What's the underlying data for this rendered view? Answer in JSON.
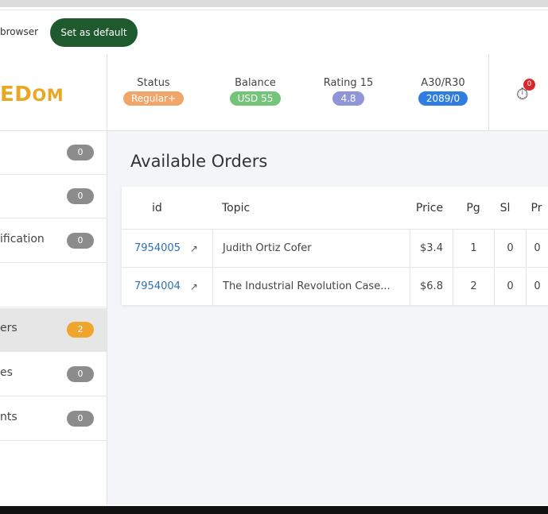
{
  "browser_bar": {
    "text": "browser",
    "button": "Set as default"
  },
  "header": {
    "logo_part1": "E",
    "logo_part2": "D",
    "logo_part3": "OM",
    "stats": [
      {
        "label": "Status",
        "value": "Regular+",
        "color": "#f0a56a"
      },
      {
        "label": "Balance",
        "value": "USD 55",
        "color": "#74c47a"
      },
      {
        "label": "Rating 15",
        "value": "4.8",
        "color": "#8f95d6"
      },
      {
        "label": "A30/R30",
        "value": "2089/0",
        "color": "#2f7de1"
      }
    ],
    "timer_icon": "stopwatch-icon",
    "timer_badge": "0"
  },
  "sidebar": {
    "items": [
      {
        "label": "",
        "badge": "0"
      },
      {
        "label": "",
        "badge": "0"
      },
      {
        "label": "ification",
        "badge": "0"
      },
      {
        "label": "",
        "badge": ""
      },
      {
        "label": "ers",
        "badge": "2",
        "active": true
      },
      {
        "label": "es",
        "badge": "0"
      },
      {
        "label": "nts",
        "badge": "0"
      }
    ]
  },
  "main": {
    "title": "Available Orders",
    "columns": [
      "id",
      "Topic",
      "Price",
      "Pg",
      "Sl",
      "Pr"
    ],
    "rows": [
      {
        "id": "7954005",
        "topic": "Judith Ortiz Cofer",
        "price": "$3.4",
        "pg": "1",
        "sl": "0",
        "pr": "0"
      },
      {
        "id": "7954004",
        "topic": "The Industrial Revolution Case...",
        "price": "$6.8",
        "pg": "2",
        "sl": "0",
        "pr": "0"
      }
    ],
    "external_link_icon": "external-link-icon"
  }
}
